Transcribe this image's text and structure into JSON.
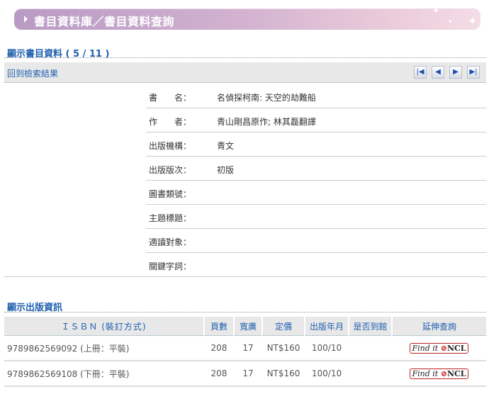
{
  "banner": {
    "title": "書目資料庫／書目資料查詢"
  },
  "section1": {
    "title": "顯示書目資料 ( 5 / 11 )",
    "back_link": "回到檢索結果"
  },
  "nav": {
    "first": "|◀",
    "prev": "◀",
    "next": "▶",
    "last": "▶|"
  },
  "fields": [
    {
      "label": "書　　名：",
      "value": "名偵探柯南: 天空的劫難船"
    },
    {
      "label": "作　　者：",
      "value": "青山剛昌原作; 林其磊翻譯"
    },
    {
      "label": "出版機構：",
      "value": "青文"
    },
    {
      "label": "出版版次：",
      "value": "初版"
    },
    {
      "label": "圖書類號：",
      "value": ""
    },
    {
      "label": "主題標題：",
      "value": ""
    },
    {
      "label": "適讀對象：",
      "value": ""
    },
    {
      "label": "關鍵字詞：",
      "value": ""
    }
  ],
  "section2": {
    "title": "顯示出版資訊"
  },
  "table": {
    "headers": [
      "ＩＳＢＮ (裝訂方式)",
      "頁數",
      "寬廣",
      "定價",
      "出版年月",
      "是否到館",
      "延伸查詢"
    ],
    "rows": [
      {
        "isbn": "9789862569092 (上冊：平裝)",
        "pages": "208",
        "width": "17",
        "price": "NT$160",
        "date": "100/10",
        "arrived": "",
        "link": "Find it",
        "link2": "NCL"
      },
      {
        "isbn": "9789862569108 (下冊：平裝)",
        "pages": "208",
        "width": "17",
        "price": "NT$160",
        "date": "100/10",
        "arrived": "",
        "link": "Find it",
        "link2": "NCL"
      }
    ]
  }
}
